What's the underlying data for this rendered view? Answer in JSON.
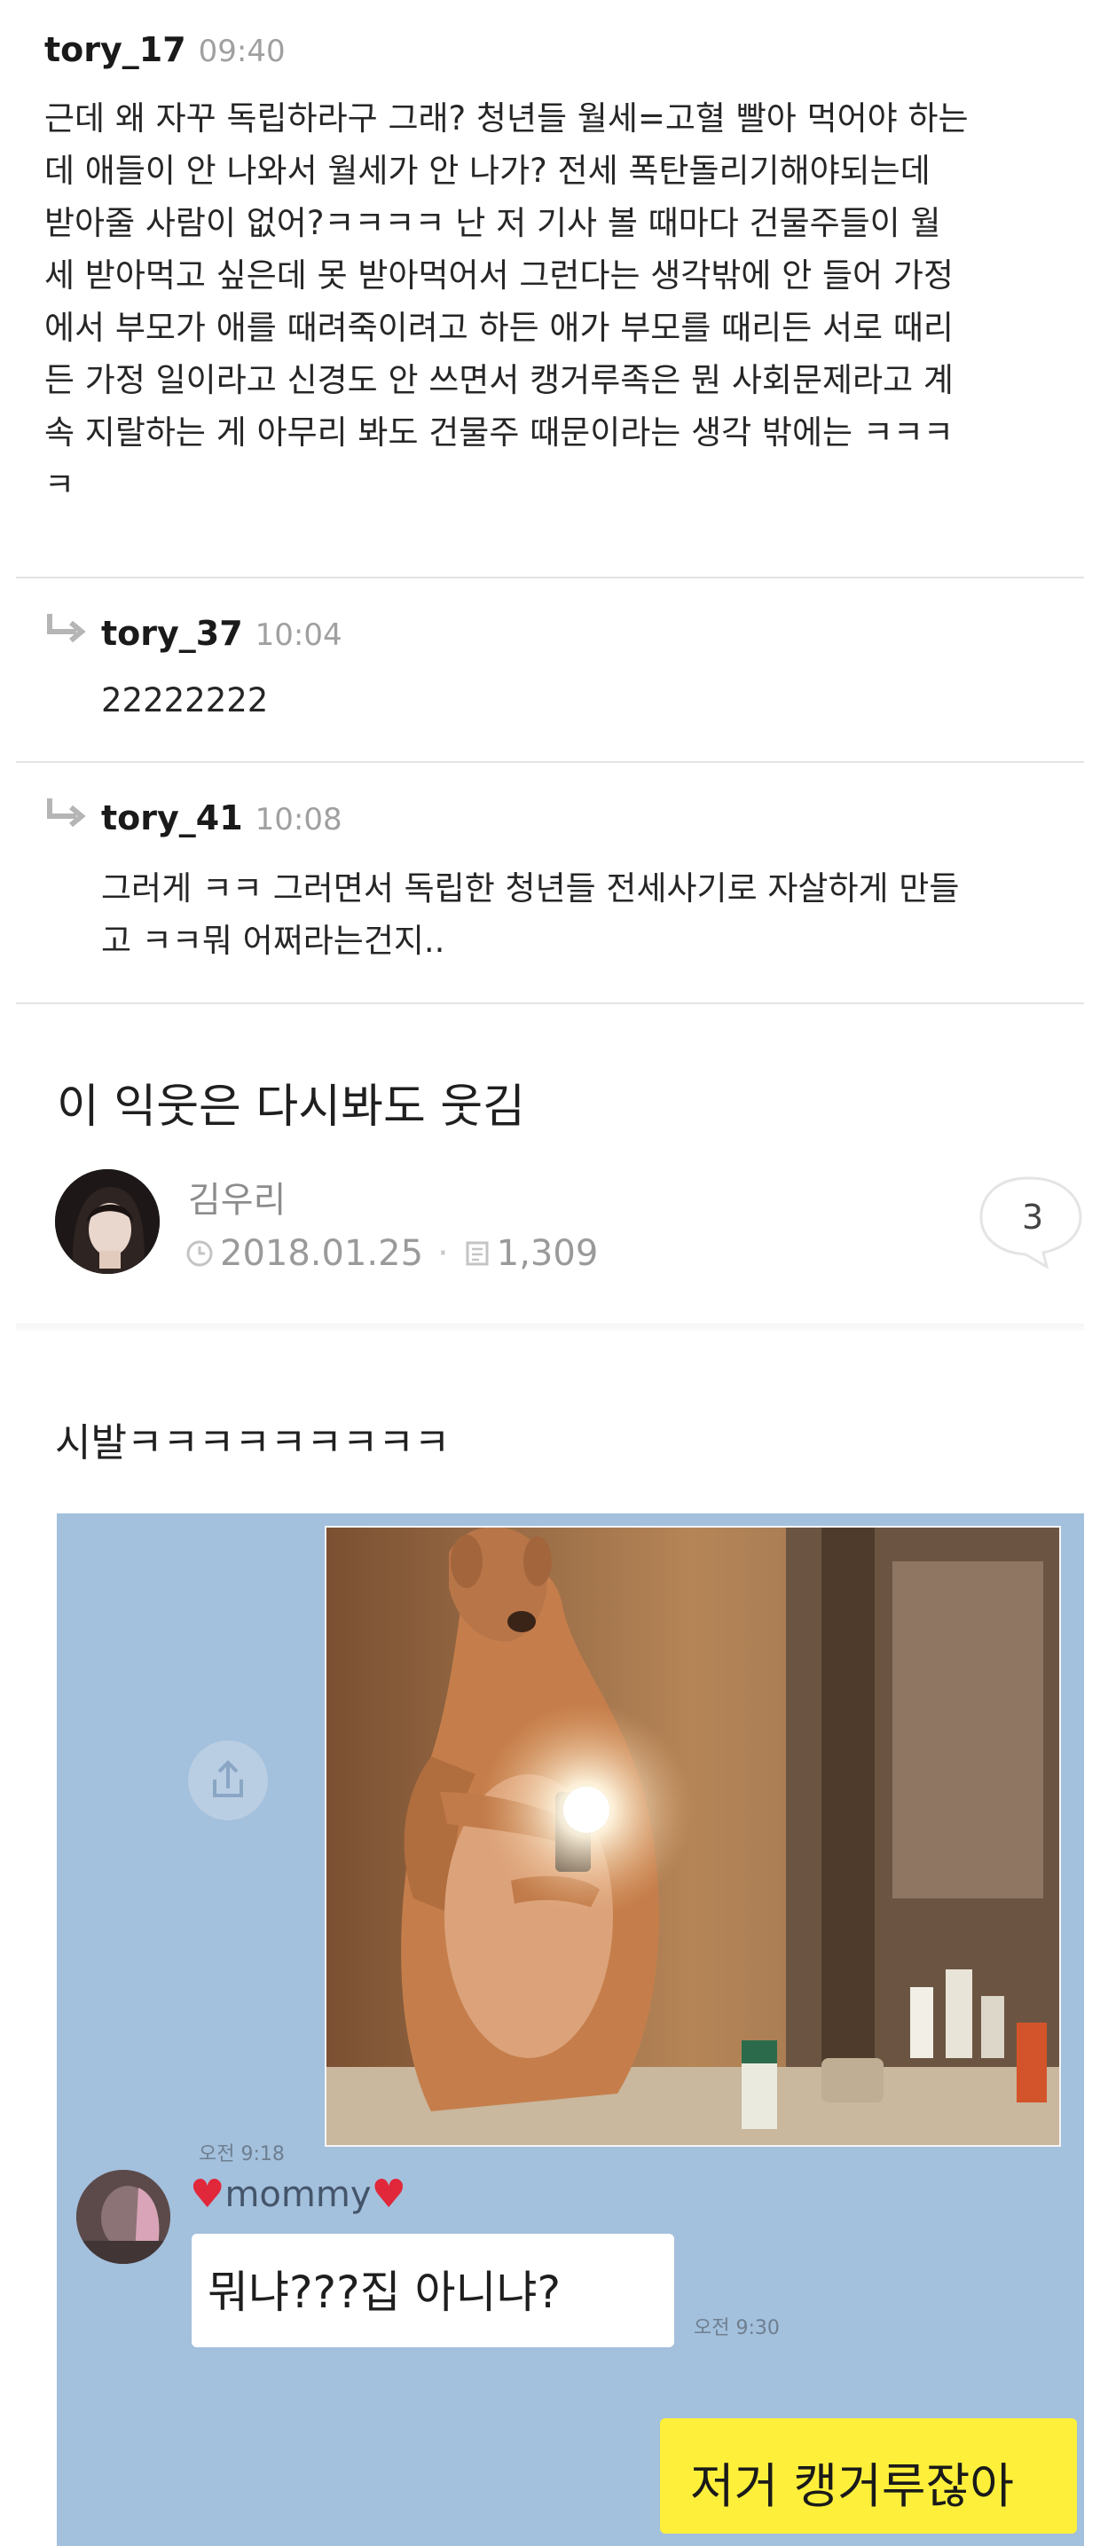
{
  "comments": [
    {
      "username": "tory_17",
      "time": "09:40",
      "body": "근데 왜 자꾸 독립하라구 그래? 청년들 월세=고혈 빨아 먹어야 하는\n데 애들이 안 나와서 월세가 안 나가? 전세 폭탄돌리기해야되는데\n받아줄 사람이 없어?ㅋㅋㅋㅋ 난 저 기사 볼 때마다 건물주들이 월\n세 받아먹고 싶은데 못 받아먹어서 그런다는 생각밖에 안 들어 가정\n에서 부모가 애를 때려죽이려고 하든 애가 부모를 때리든 서로 때리\n든 가정 일이라고 신경도 안 쓰면서 캥거루족은 뭔 사회문제라고 계\n속 지랄하는 게 아무리 봐도 건물주 때문이라는 생각 밖에는 ㅋㅋㅋ\nㅋ"
    },
    {
      "username": "tory_37",
      "time": "10:04",
      "body": "22222222"
    },
    {
      "username": "tory_41",
      "time": "10:08",
      "body": "그러게 ㅋㅋ 그러면서 독립한 청년들 전세사기로 자살하게 만들\n고 ㅋㅋ뭐 어쩌라는건지.."
    }
  ],
  "post": {
    "title": "이 익웃은 다시봐도 웃김",
    "author": "김우리",
    "date": "2018.01.25",
    "views": "1,309",
    "comment_count": "3",
    "body_text": "시발ㅋㅋㅋㅋㅋㅋㅋㅋㅋ"
  },
  "chat": {
    "photo_time": "오전 9:18",
    "sender_name": "mommy",
    "message_1": "뭐냐???집 아니냐?",
    "message_1_time": "오전 9:30",
    "message_2": "저거 캥거루잖아"
  },
  "colors": {
    "chat_background": "#a3c0dd",
    "my_bubble": "#fef03a",
    "heart": "#e0283a"
  }
}
